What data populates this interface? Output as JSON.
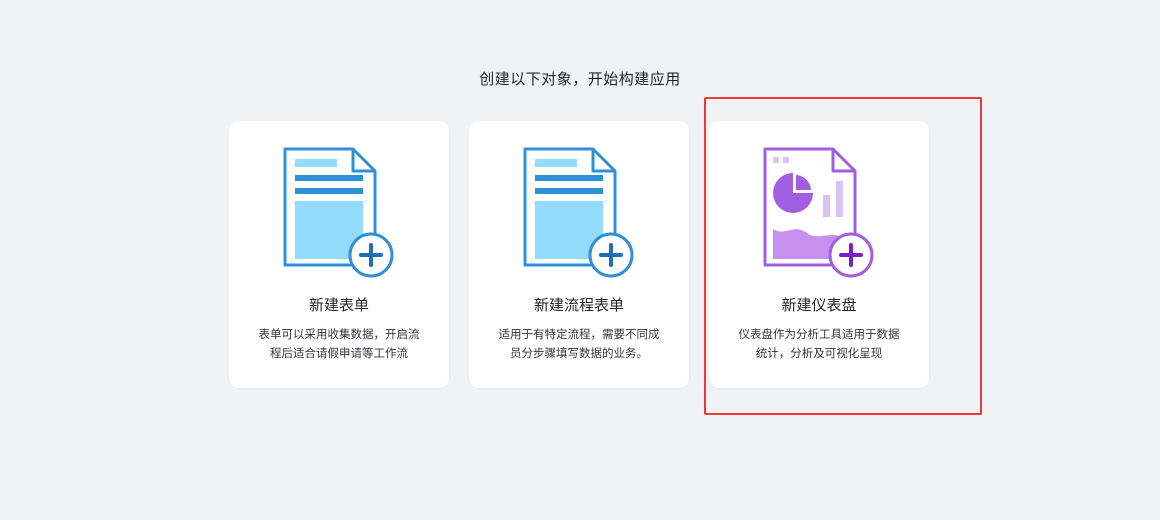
{
  "heading": "创建以下对象，开始构建应用",
  "cards": [
    {
      "title": "新建表单",
      "description": "表单可以采用收集数据，开启流程后适合请假申请等工作流",
      "icon": "form-doc-plus-icon",
      "accent": "#2f8fd8"
    },
    {
      "title": "新建流程表单",
      "description": "适用于有特定流程，需要不同成员分步骤填写数据的业务。",
      "icon": "process-form-doc-plus-icon",
      "accent": "#2f8fd8"
    },
    {
      "title": "新建仪表盘",
      "description": "仪表盘作为分析工具适用于数据统计，分析及可视化呈现",
      "icon": "dashboard-doc-plus-icon",
      "accent": "#a05ee0"
    }
  ],
  "colors": {
    "background": "#f0f2f5",
    "card": "#ffffff",
    "highlight_border": "#ea3a33",
    "blue_accent": "#2f8fd8",
    "blue_light": "#93dbfa",
    "purple_accent": "#a05ee0",
    "purple_light": "#d9c2f5"
  }
}
